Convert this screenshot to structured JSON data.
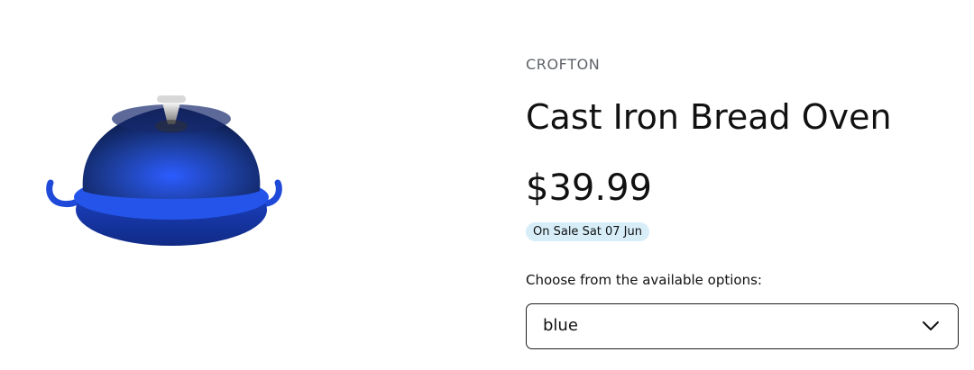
{
  "product": {
    "brand": "CROFTON",
    "title": "Cast Iron Bread Oven",
    "price": "$39.99",
    "sale_badge": "On Sale Sat 07 Jun",
    "options_label": "Choose from the available options:",
    "selected_option": "blue",
    "image_icon": "cast-iron-bread-oven-image"
  },
  "colors": {
    "badge_bg": "#d7eef9",
    "product_blue": "#1d3fa0"
  }
}
